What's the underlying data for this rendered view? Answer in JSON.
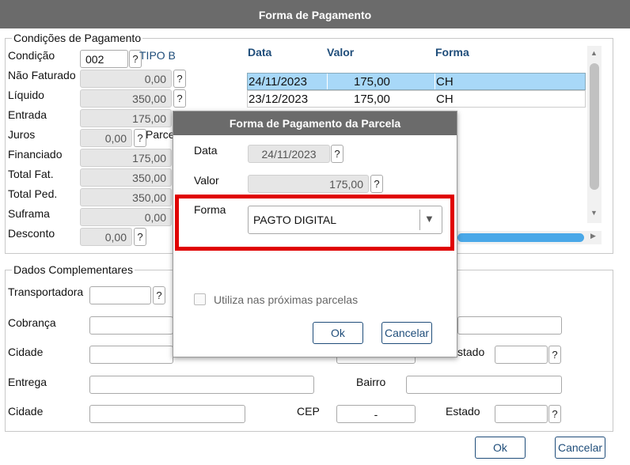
{
  "window": {
    "title": "Forma de Pagamento"
  },
  "condicoes": {
    "legend": "Condições de Pagamento",
    "condicao_label": "Condição",
    "condicao_value": "002",
    "tipo_label": "TIPO B",
    "nao_faturado_label": "Não Faturado",
    "nao_faturado_value": "0,00",
    "liquido_label": "Líquido",
    "liquido_value": "350,00",
    "entrada_label": "Entrada",
    "entrada_value": "175,00",
    "juros_label": "Juros",
    "juros_value": "0,00",
    "parcelas_label": "Parce",
    "financiado_label": "Financiado",
    "financiado_value": "175,00",
    "total_fat_label": "Total Fat.",
    "total_fat_value": "350,00",
    "total_ped_label": "Total Ped.",
    "total_ped_value": "350,00",
    "suframa_label": "Suframa",
    "suframa_value": "0,00",
    "desconto_label": "Desconto",
    "desconto_value": "0,00",
    "help": "?"
  },
  "parcelas_table": {
    "headers": {
      "data": "Data",
      "valor": "Valor",
      "forma": "Forma"
    },
    "rows": [
      {
        "data": "24/11/2023",
        "valor": "175,00",
        "forma": "CH"
      },
      {
        "data": "23/12/2023",
        "valor": "175,00",
        "forma": "CH"
      }
    ]
  },
  "complementares": {
    "legend": "Dados Complementares",
    "transportadora_label": "Transportadora",
    "cobranca_label": "Cobrança",
    "cidade_label": "Cidade",
    "estado_label": "stado",
    "entrega_label": "Entrega",
    "bairro_label": "Bairro",
    "cidade2_label": "Cidade",
    "cep_label": "CEP",
    "cep_value": "-",
    "estado2_label": "Estado"
  },
  "footer": {
    "ok": "Ok",
    "cancelar": "Cancelar"
  },
  "dialog": {
    "title": "Forma de Pagamento da Parcela",
    "data_label": "Data",
    "data_value": "24/11/2023",
    "valor_label": "Valor",
    "valor_value": "175,00",
    "forma_label": "Forma",
    "forma_value": "PAGTO DIGITAL",
    "checkbox_label": "Utiliza nas próximas parcelas",
    "ok": "Ok",
    "cancelar": "Cancelar"
  },
  "colors": {
    "titlebar": "#6b6b6b",
    "selected_row": "#a8d8f8",
    "highlight": "#e00000",
    "accent": "#1f4d7a"
  }
}
